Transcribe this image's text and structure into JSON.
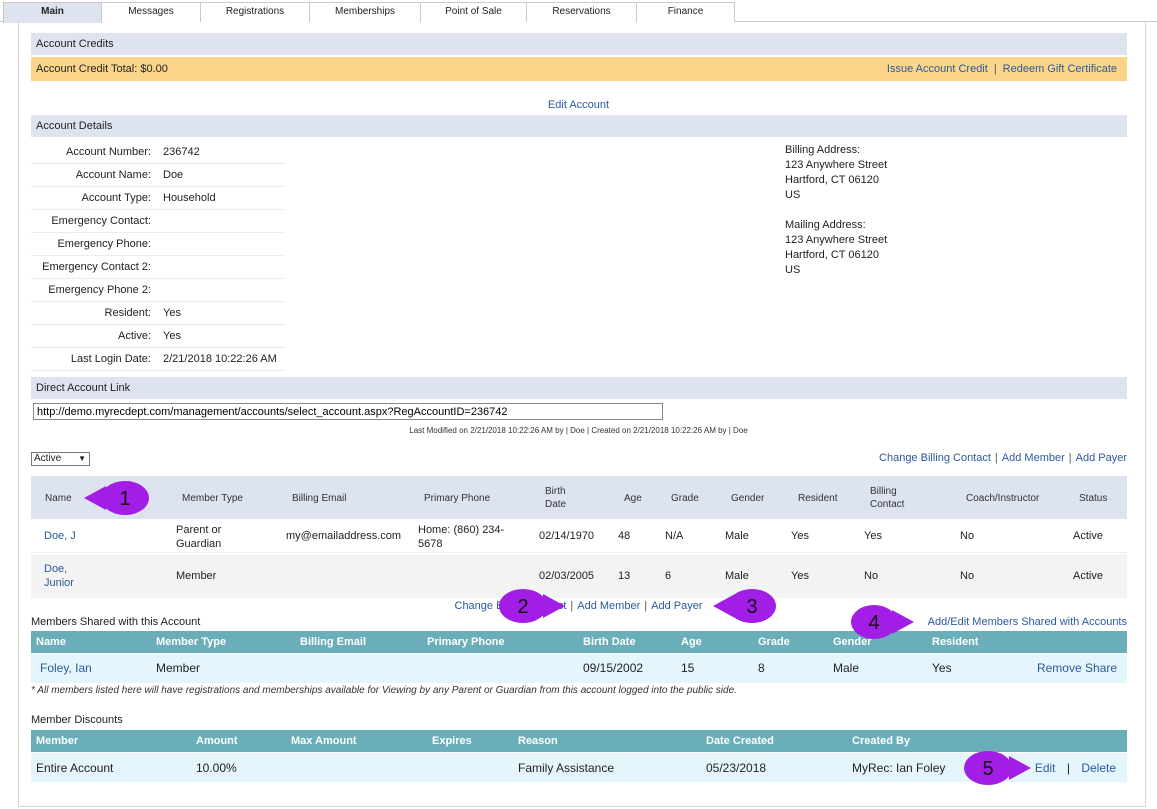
{
  "tabs": [
    "Main",
    "Messages",
    "Registrations",
    "Memberships",
    "Point of Sale",
    "Reservations",
    "Finance"
  ],
  "account_credits": {
    "header": "Account Credits",
    "total_label": "Account Credit Total:",
    "total_value": "$0.00",
    "issue_link": "Issue Account Credit",
    "separator": "|",
    "redeem_link": "Redeem Gift Certificate"
  },
  "edit_account": "Edit Account",
  "account_details": {
    "header": "Account Details",
    "rows": [
      {
        "key": "Account Number:",
        "value": "236742"
      },
      {
        "key": "Account Name:",
        "value": "Doe"
      },
      {
        "key": "Account Type:",
        "value": "Household"
      },
      {
        "key": "Emergency Contact:",
        "value": ""
      },
      {
        "key": "Emergency Phone:",
        "value": ""
      },
      {
        "key": "Emergency Contact 2:",
        "value": ""
      },
      {
        "key": "Emergency Phone 2:",
        "value": ""
      },
      {
        "key": "Resident:",
        "value": "Yes"
      },
      {
        "key": "Active:",
        "value": "Yes"
      },
      {
        "key": "Last Login Date:",
        "value": "2/21/2018 10:22:26 AM"
      }
    ],
    "billing": {
      "title": "Billing Address:",
      "line1": "123 Anywhere Street",
      "line2": "Hartford, CT 06120",
      "line3": "US"
    },
    "mailing": {
      "title": "Mailing Address:",
      "line1": "123 Anywhere Street",
      "line2": "Hartford, CT 06120",
      "line3": "US"
    }
  },
  "direct_link": {
    "header": "Direct Account Link",
    "value": "http://demo.myrecdept.com/management/accounts/select_account.aspx?RegAccountID=236742"
  },
  "modified": "Last Modified on 2/21/2018 10:22:26 AM by | Doe | Created on 2/21/2018 10:22:26 AM by | Doe",
  "filter": {
    "selected": "Active"
  },
  "top_links": {
    "change_billing": "Change Billing Contact",
    "add_member": "Add Member",
    "add_payer": "Add Payer",
    "sep": "|"
  },
  "members": {
    "headers": {
      "name": "Name",
      "member_type": "Member Type",
      "billing_email": "Billing Email",
      "primary_phone": "Primary Phone",
      "birth_date_1": "Birth",
      "birth_date_2": "Date",
      "age": "Age",
      "grade": "Grade",
      "gender": "Gender",
      "resident": "Resident",
      "billing_contact_1": "Billing",
      "billing_contact_2": "Contact",
      "coach": "Coach/Instructor",
      "status": "Status"
    },
    "rows": [
      {
        "name": "Doe, J",
        "name2": "",
        "type1": "Parent or",
        "type2": "Guardian",
        "email": "my@emailaddress.com",
        "phone1": "Home: (860) 234-",
        "phone2": "5678",
        "birth": "02/14/1970",
        "age": "48",
        "grade": "N/A",
        "gender": "Male",
        "resident": "Yes",
        "billing": "Yes",
        "coach": "No",
        "status": "Active"
      },
      {
        "name": "Doe,",
        "name2": "Junior",
        "type1": "Member",
        "type2": "",
        "email": "",
        "phone1": "",
        "phone2": "",
        "birth": "02/03/2005",
        "age": "13",
        "grade": "6",
        "gender": "Male",
        "resident": "Yes",
        "billing": "No",
        "coach": "No",
        "status": "Active"
      }
    ]
  },
  "mid_links": {
    "change_billing": "Change Billing Contact",
    "add_member": "Add Member",
    "add_payer": "Add Payer",
    "sep": "|"
  },
  "shared": {
    "title": "Members Shared with this Account",
    "add_edit_link": "Add/Edit Members Shared with Accounts",
    "headers": {
      "name": "Name",
      "member_type": "Member Type",
      "billing_email": "Billing Email",
      "primary_phone": "Primary Phone",
      "birth_date": "Birth Date",
      "age": "Age",
      "grade": "Grade",
      "gender": "Gender",
      "resident": "Resident"
    },
    "row": {
      "name": "Foley, Ian",
      "type": "Member",
      "email": "",
      "phone": "",
      "birth": "09/15/2002",
      "age": "15",
      "grade": "8",
      "gender": "Male",
      "resident": "Yes",
      "remove": "Remove Share"
    },
    "note": "* All members listed here will have registrations and memberships available for Viewing by any Parent or Guardian from this account logged into the public side."
  },
  "discounts": {
    "title": "Member Discounts",
    "headers": {
      "member": "Member",
      "amount": "Amount",
      "max_amount": "Max Amount",
      "expires": "Expires",
      "reason": "Reason",
      "date_created": "Date Created",
      "created_by": "Created By"
    },
    "row": {
      "member": "Entire Account",
      "amount": "10.00%",
      "max_amount": "",
      "expires": "",
      "reason": "Family Assistance",
      "date_created": "05/23/2018",
      "created_by": "MyRec: Ian Foley",
      "edit": "Edit",
      "sep": "|",
      "delete": "Delete"
    }
  },
  "callouts": [
    "1",
    "2",
    "3",
    "4",
    "5"
  ],
  "colors": {
    "tab_active": "#dde3ef",
    "section_bar": "#dde3ef",
    "credit_bar": "#fbd58a",
    "teal_header": "#6aaeb9",
    "teal_row": "#e4f6fb",
    "link": "#2b5a9b",
    "callout": "#a21ee6"
  }
}
